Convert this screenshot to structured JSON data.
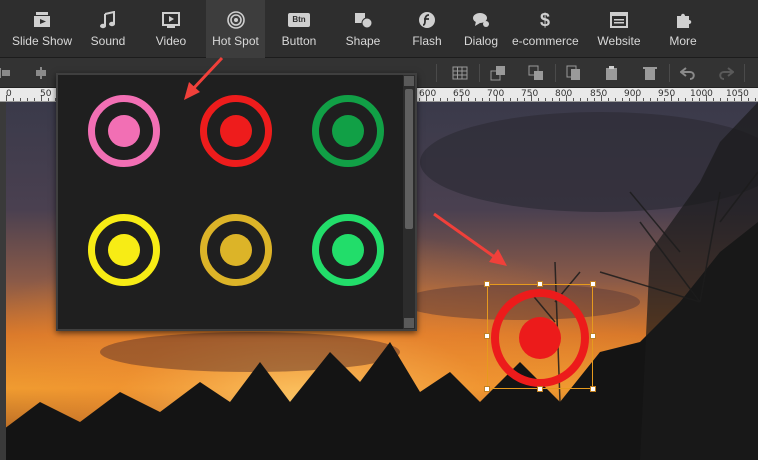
{
  "top_toolbar": {
    "items": [
      {
        "label": "Slide Show",
        "icon": "slideshow-icon"
      },
      {
        "label": "Sound",
        "icon": "music-note-icon"
      },
      {
        "label": "Video",
        "icon": "video-icon"
      },
      {
        "label": "Hot Spot",
        "icon": "target-icon",
        "active": true
      },
      {
        "label": "Button",
        "icon": "btn-icon",
        "icon_text": "Btn"
      },
      {
        "label": "Shape",
        "icon": "shape-icon"
      },
      {
        "label": "Flash",
        "icon": "flash-icon"
      },
      {
        "label": "Dialog",
        "icon": "dialog-icon"
      },
      {
        "label": "e-commerce",
        "icon": "dollar-icon",
        "icon_text": "$"
      },
      {
        "label": "Website",
        "icon": "website-icon"
      },
      {
        "label": "More",
        "icon": "puzzle-icon"
      }
    ]
  },
  "ruler": {
    "labels": [
      "0",
      "50",
      "600",
      "650",
      "700",
      "750",
      "800",
      "850",
      "900",
      "950",
      "1000",
      "1050"
    ]
  },
  "hotspot_picker": {
    "styles": [
      {
        "name": "pink",
        "color": "#f26fb4"
      },
      {
        "name": "red",
        "color": "#ee1c1c"
      },
      {
        "name": "green",
        "color": "#11a046"
      },
      {
        "name": "yellow",
        "color": "#f7ec15"
      },
      {
        "name": "gold",
        "color": "#dcb428"
      },
      {
        "name": "light-green",
        "color": "#22dd6a"
      }
    ]
  },
  "colors": {
    "selection_border": "#e69a1e",
    "arrow": "#f0403a",
    "placed_hotspot": "#ec1b1b"
  }
}
